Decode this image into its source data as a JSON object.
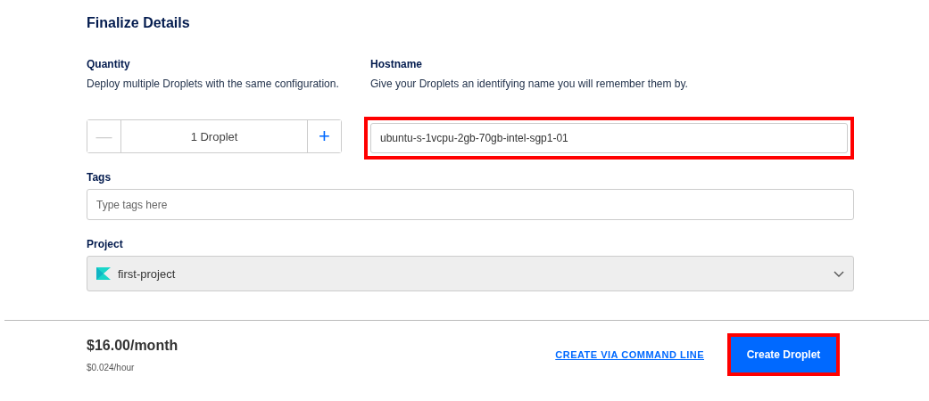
{
  "title": "Finalize Details",
  "quantity": {
    "label": "Quantity",
    "description": "Deploy multiple Droplets with the same configuration.",
    "decrement": "—",
    "value": "1 Droplet",
    "increment": "+"
  },
  "hostname": {
    "label": "Hostname",
    "description": "Give your Droplets an identifying name you will remember them by.",
    "value": "ubuntu-s-1vcpu-2gb-70gb-intel-sgp1-01",
    "highlighted": true
  },
  "tags": {
    "label": "Tags",
    "placeholder": "Type tags here"
  },
  "project": {
    "label": "Project",
    "value": "first-project"
  },
  "footer": {
    "price": "$16.00/month",
    "hourly": "$0.024/hour",
    "link": "CREATE VIA COMMAND LINE",
    "button": "Create Droplet",
    "button_highlighted": true
  }
}
